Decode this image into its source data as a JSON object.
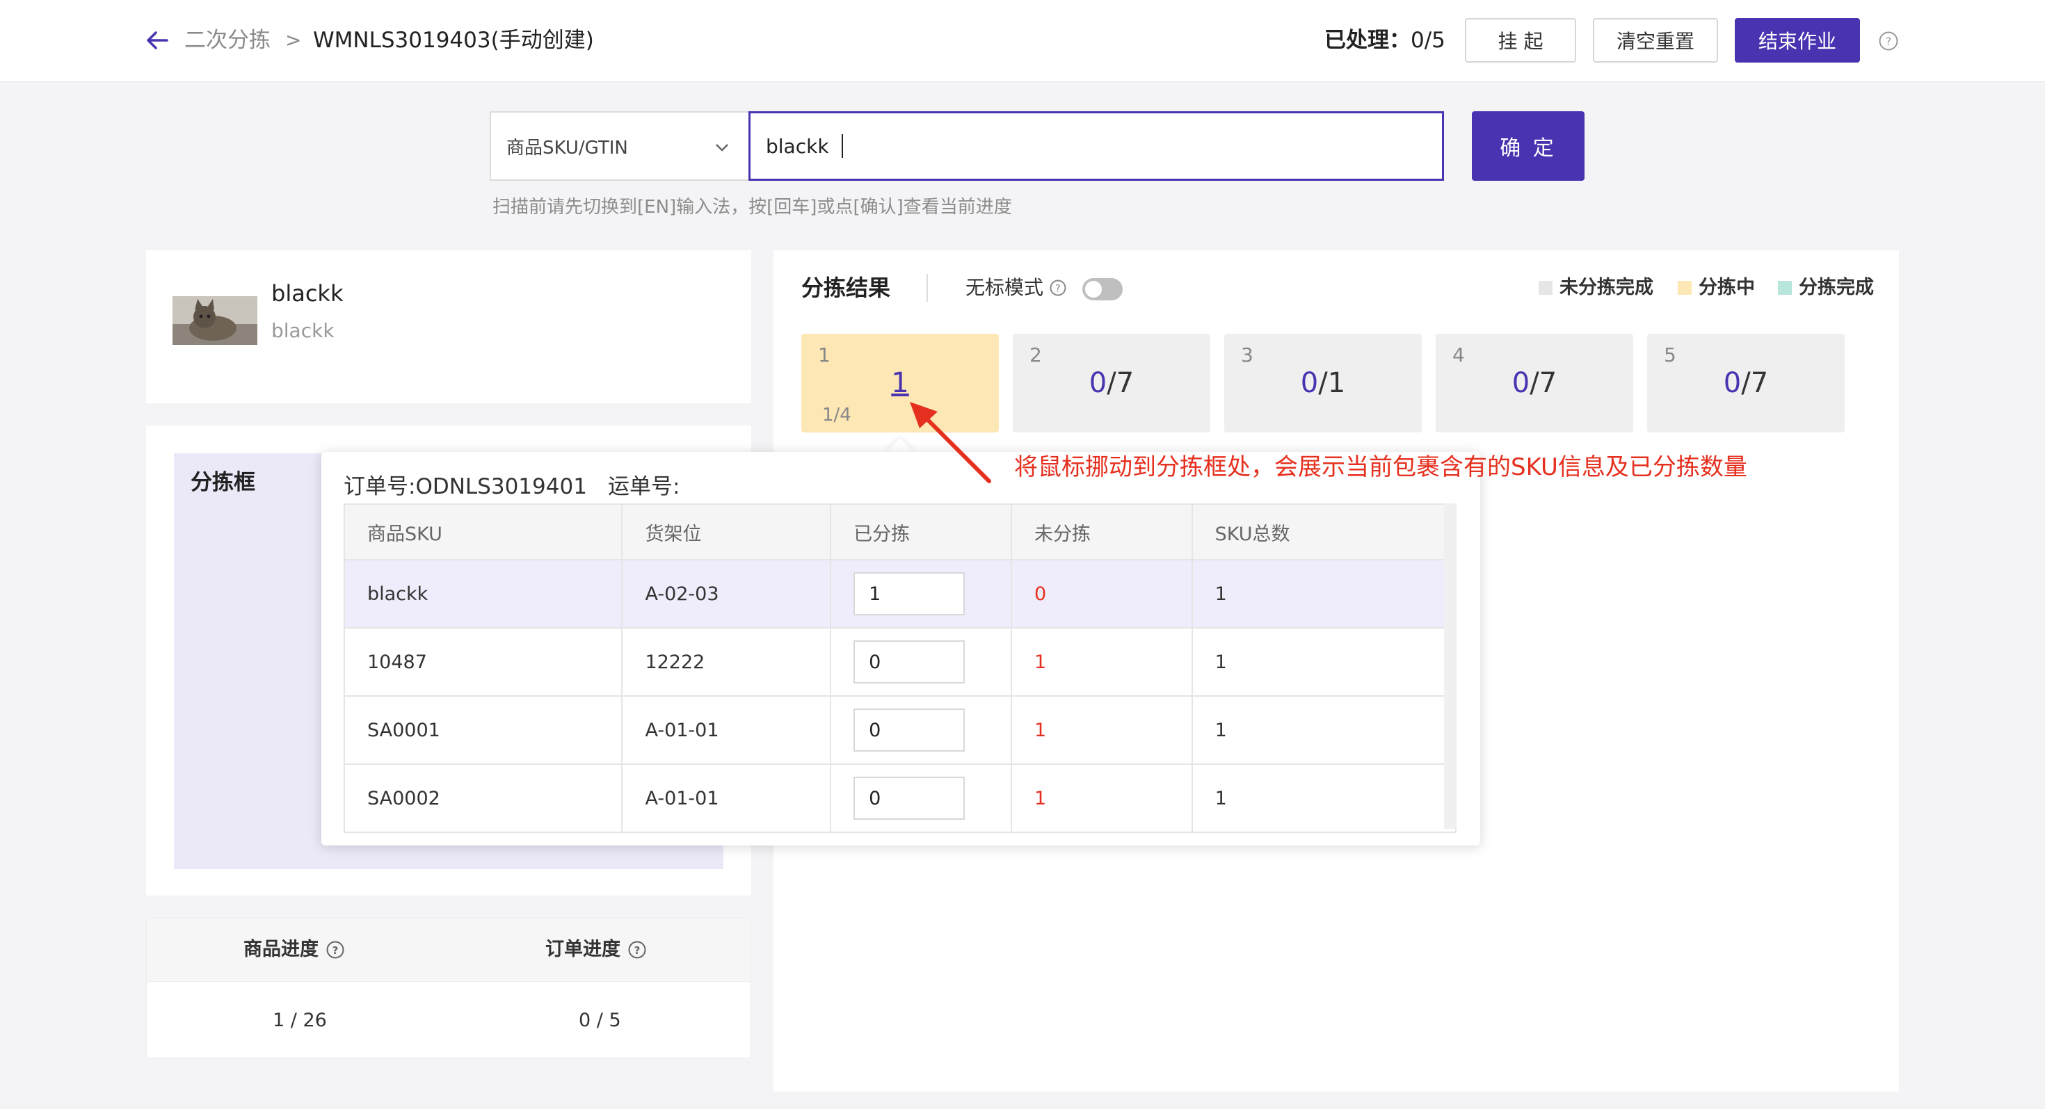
{
  "header": {
    "breadcrumb_prev": "二次分拣",
    "breadcrumb_sep": ">",
    "breadcrumb_current": "WMNLS3019403(手动创建)",
    "processed_label": "已处理：",
    "processed_value": "0/5",
    "suspend_label": "挂 起",
    "reset_label": "清空重置",
    "finish_label": "结束作业"
  },
  "search": {
    "type_value": "商品SKU/GTIN",
    "input_value": "blackk",
    "confirm_label": "确 定",
    "hint": "扫描前请先切换到[EN]输入法，按[回车]或点[确认]查看当前进度"
  },
  "product": {
    "name": "blackk",
    "sub": "blackk"
  },
  "sort_box": {
    "title": "分拣框"
  },
  "progress": {
    "goods_label": "商品进度",
    "order_label": "订单进度",
    "goods_value": "1 / 26",
    "order_value": "0 / 5"
  },
  "results": {
    "title": "分拣结果",
    "mode_label": "无标模式",
    "legend": [
      {
        "label": "未分拣完成",
        "color": "#e6e6e6"
      },
      {
        "label": "分拣中",
        "color": "#fde7b5"
      },
      {
        "label": "分拣完成",
        "color": "#b8e6dc"
      }
    ],
    "slots": [
      {
        "num": "1",
        "value": "1",
        "sub": "1/4"
      },
      {
        "num": "2",
        "done": "0",
        "total": "/7"
      },
      {
        "num": "3",
        "done": "0",
        "total": "/1"
      },
      {
        "num": "4",
        "done": "0",
        "total": "/7"
      },
      {
        "num": "5",
        "done": "0",
        "total": "/7"
      }
    ],
    "annotation": "将鼠标挪动到分拣框处，会展示当前包裹含有的SKU信息及已分拣数量"
  },
  "popover": {
    "order_label": "订单号:ODNLS3019401",
    "ship_label": "运单号:",
    "columns": [
      "商品SKU",
      "货架位",
      "已分拣",
      "未分拣",
      "SKU总数"
    ],
    "rows": [
      {
        "sku": "blackk",
        "shelf": "A-02-03",
        "picked": "1",
        "unpicked": "0",
        "total": "1"
      },
      {
        "sku": "10487",
        "shelf": "12222",
        "picked": "0",
        "unpicked": "1",
        "total": "1"
      },
      {
        "sku": "SA0001",
        "shelf": "A-01-01",
        "picked": "0",
        "unpicked": "1",
        "total": "1"
      },
      {
        "sku": "SA0002",
        "shelf": "A-01-01",
        "picked": "0",
        "unpicked": "1",
        "total": "1"
      }
    ]
  }
}
